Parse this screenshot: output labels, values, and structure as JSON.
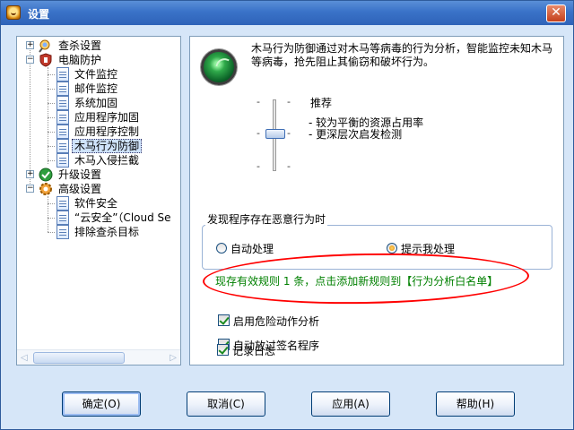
{
  "window": {
    "title": "设置",
    "close_label": "✕"
  },
  "tree": {
    "items": [
      {
        "label": "查杀设置",
        "icon": "scan-shield-icon",
        "expander": "+"
      },
      {
        "label": "电脑防护",
        "icon": "hand-shield-icon",
        "expander": "−"
      },
      {
        "label": "文件监控",
        "icon": "page-icon"
      },
      {
        "label": "邮件监控",
        "icon": "page-icon"
      },
      {
        "label": "系统加固",
        "icon": "page-icon"
      },
      {
        "label": "应用程序加固",
        "icon": "page-icon"
      },
      {
        "label": "应用程序控制",
        "icon": "page-icon"
      },
      {
        "label": "木马行为防御",
        "icon": "page-icon",
        "selected": true
      },
      {
        "label": "木马入侵拦截",
        "icon": "page-icon"
      },
      {
        "label": "升级设置",
        "icon": "update-check-icon",
        "expander": "+"
      },
      {
        "label": "高级设置",
        "icon": "gear-icon",
        "expander": "−"
      },
      {
        "label": "软件安全",
        "icon": "page-icon"
      },
      {
        "label": "“云安全”（Cloud Se",
        "icon": "page-icon"
      },
      {
        "label": "排除查杀目标",
        "icon": "page-icon"
      }
    ],
    "scroll_left": "◁",
    "scroll_right": "▷"
  },
  "panel": {
    "description": "木马行为防御通过对木马等病毒的行为分析，智能监控未知木马等病毒，抢先阻止其偷窃和破坏行为。",
    "level_title": "推荐",
    "level_desc_1": "- 较为平衡的资源占用率",
    "level_desc_2": "- 更深层次启发检测",
    "tick": "-",
    "slider_level": "recommended",
    "group_title": "发现程序存在恶意行为时",
    "radio_auto": "自动处理",
    "radio_prompt": "提示我处理",
    "radio_selected": "提示我处理",
    "rule_text": "现存有效规则 1 条，点击添加新规则到【行为分析白名单】",
    "check_danger": "启用危险动作分析",
    "check_signed": "自动放过签名程序",
    "check_log": "记录日志"
  },
  "buttons": {
    "ok": "确定(O)",
    "cancel": "取消(C)",
    "apply": "应用(A)",
    "help": "帮助(H)"
  },
  "colors": {
    "annotation_red": "#ff0000",
    "link_green": "#008000",
    "title_blue": "#3a72c8"
  }
}
